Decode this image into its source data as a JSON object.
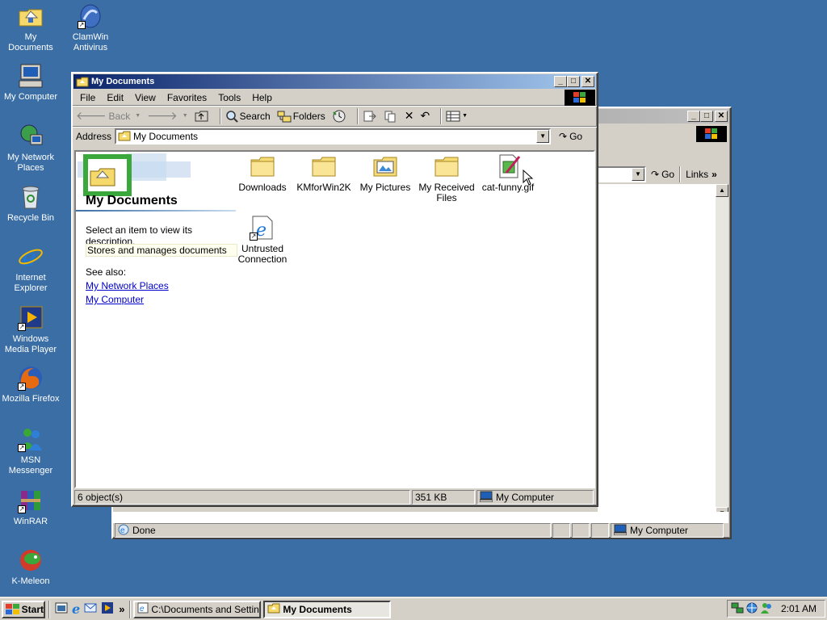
{
  "desktop": {
    "icons": [
      {
        "label": "My Documents",
        "icon": "folder-documents-icon"
      },
      {
        "label": "ClamWin Antivirus",
        "icon": "clamwin-icon"
      },
      {
        "label": "My Computer",
        "icon": "computer-icon"
      },
      {
        "label": "My Network Places",
        "icon": "network-icon"
      },
      {
        "label": "Recycle Bin",
        "icon": "recycle-bin-icon"
      },
      {
        "label": "Internet Explorer",
        "icon": "ie-icon"
      },
      {
        "label": "Windows Media Player",
        "icon": "media-player-icon"
      },
      {
        "label": "Mozilla Firefox",
        "icon": "firefox-icon"
      },
      {
        "label": "MSN Messenger",
        "icon": "msn-icon"
      },
      {
        "label": "WinRAR",
        "icon": "winrar-icon"
      },
      {
        "label": "K-Meleon",
        "icon": "kmeleon-icon"
      }
    ]
  },
  "back_window": {
    "go_label": "Go",
    "links_label": "Links",
    "status_text": "Done",
    "zone_text": "My Computer"
  },
  "window": {
    "title": "My Documents",
    "menu": [
      "File",
      "Edit",
      "View",
      "Favorites",
      "Tools",
      "Help"
    ],
    "toolbar": {
      "back": "Back",
      "search": "Search",
      "folders": "Folders"
    },
    "address_label": "Address",
    "address_value": "My Documents",
    "go_label": "Go",
    "sidebar": {
      "title": "My Documents",
      "hint": "Select an item to view its description.",
      "description": "Stores and manages documents",
      "see_also": "See also:",
      "links": [
        "My Network Places",
        "My Computer"
      ]
    },
    "files": [
      {
        "name": "Downloads",
        "icon": "folder-icon"
      },
      {
        "name": "KMforWin2K",
        "icon": "folder-icon"
      },
      {
        "name": "My Pictures",
        "icon": "folder-pictures-icon"
      },
      {
        "name": "My Received Files",
        "icon": "folder-icon"
      },
      {
        "name": "cat-funny.gif",
        "icon": "gif-file-icon"
      },
      {
        "name": "Untrusted Connection",
        "icon": "ie-shortcut-icon"
      }
    ],
    "status": {
      "objects": "6 object(s)",
      "size": "351 KB",
      "zone": "My Computer"
    }
  },
  "taskbar": {
    "start": "Start",
    "tasks": [
      {
        "label": "C:\\Documents and Setting...",
        "active": false
      },
      {
        "label": "My Documents",
        "active": true
      }
    ],
    "overflow": "»",
    "clock": "2:01 AM"
  }
}
